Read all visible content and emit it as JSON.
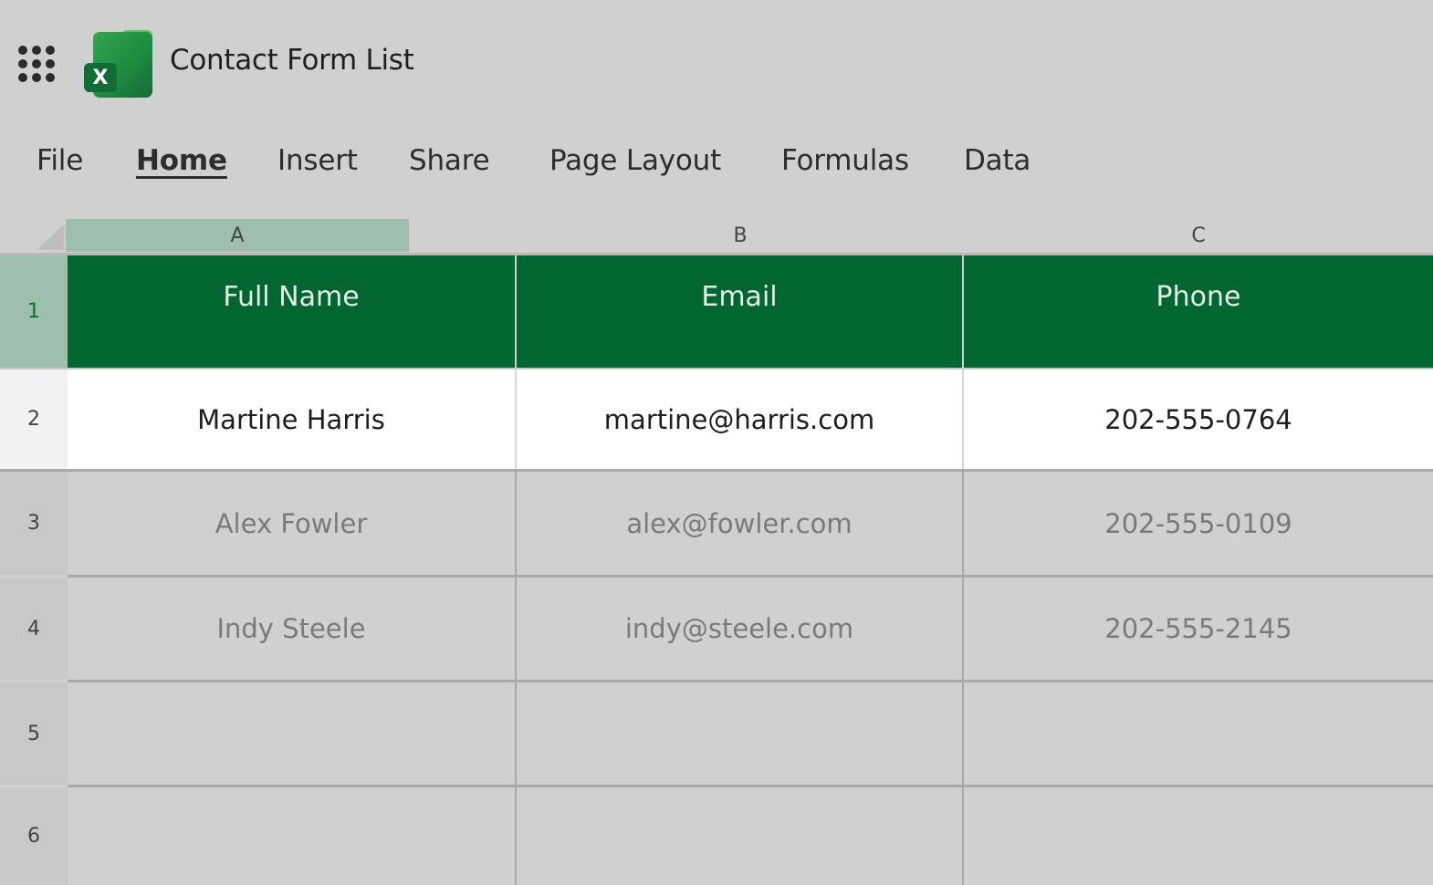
{
  "app": {
    "title": "Contact Form List",
    "logo_letter": "X",
    "icons": {
      "apps": "waffle-grid-icon",
      "logo": "excel-logo-icon"
    }
  },
  "ribbon": {
    "tabs": [
      {
        "label": "File",
        "active": false
      },
      {
        "label": "Home",
        "active": true
      },
      {
        "label": "Insert",
        "active": false
      },
      {
        "label": "Share",
        "active": false
      },
      {
        "label": "Page Layout",
        "active": false
      },
      {
        "label": "Formulas",
        "active": false
      },
      {
        "label": "Data",
        "active": false
      }
    ]
  },
  "sheet": {
    "columns": [
      "A",
      "B",
      "C"
    ],
    "row_numbers": [
      "1",
      "2",
      "3",
      "4",
      "5",
      "6"
    ],
    "header": [
      "Full Name",
      "Email",
      "Phone"
    ],
    "rows": [
      [
        "Martine Harris",
        "martine@harris.com",
        "202-555-0764"
      ],
      [
        "Alex Fowler",
        "alex@fowler.com",
        "202-555-0109"
      ],
      [
        "Indy Steele",
        "indy@steele.com",
        "202-555-2145"
      ],
      [
        "",
        "",
        ""
      ],
      [
        "",
        "",
        ""
      ]
    ],
    "colors": {
      "header_fill": "#026631",
      "header_text": "#e3ece6",
      "selection": "#9ebfad",
      "active_row": "#ffffff",
      "dim_text": "#7a7a7a"
    }
  }
}
